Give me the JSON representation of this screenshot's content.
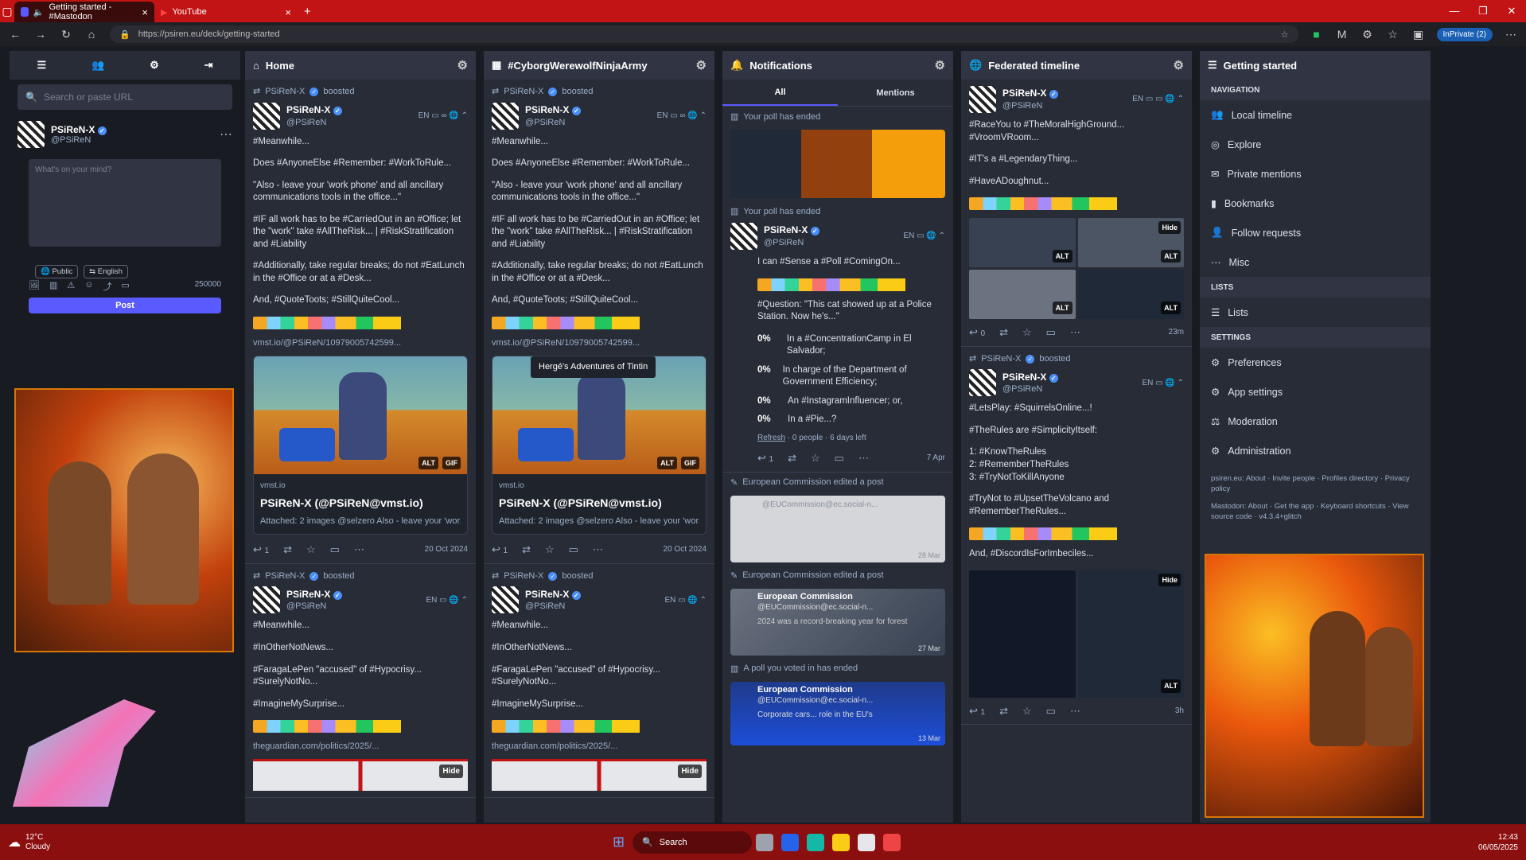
{
  "browser": {
    "tabs": [
      {
        "label": "Getting started - #Mastodon"
      },
      {
        "label": "YouTube"
      }
    ],
    "url": "https://psiren.eu/deck/getting-started",
    "inprivate_label": "InPrivate (2)"
  },
  "compose": {
    "search_placeholder": "Search or paste URL",
    "profile_name": "PSiReN-X",
    "profile_handle": "@PSiReN",
    "placeholder": "What's on your mind?",
    "visibility": "Public",
    "language": "English",
    "char_count": "250000",
    "post_label": "Post"
  },
  "columns": {
    "home": {
      "title": "Home"
    },
    "cyborg": {
      "title": "#CyborgWerewolfNinjaArmy"
    },
    "notifications": {
      "title": "Notifications",
      "tab_all": "All",
      "tab_mentions": "Mentions"
    },
    "federated": {
      "title": "Federated timeline"
    },
    "getting_started": {
      "title": "Getting started"
    }
  },
  "post1": {
    "booster": "PSiReN-X",
    "boosted": "boosted",
    "name": "PSiReN-X",
    "handle": "@PSiReN",
    "lang": "EN",
    "l1": "#Meanwhile...",
    "l2": "Does #AnyoneElse #Remember: #WorkToRule...",
    "l3": "\"Also - leave your 'work phone' and all ancillary communications tools in the office...\"",
    "l4": "#IF all work has to be #CarriedOut in an #Office; let the \"work\" take #AllTheRisk... | #RiskStratification and #Liability",
    "l5": "#Additionally, take regular breaks; do not #EatLunch in the #Office or at a #Desk...",
    "l6": "And, #QuoteToots; #StillQuiteCool...",
    "link": "vmst.io/@PSiReN/10979005742599...",
    "card_src": "vmst.io",
    "card_title": "PSiReN-X (@PSiReN@vmst.io)",
    "card_desc": "Attached: 2 images @selzero Also - leave your 'wor...",
    "alt": "ALT",
    "gif": "GIF",
    "tooltip": "Hergé's Adventures of Tintin",
    "replies": "1",
    "date": "20 Oct 2024"
  },
  "post2": {
    "l1": "#Meanwhile...",
    "l2": "#InOtherNotNews...",
    "l3": "#FaragaLePen \"accused\" of #Hypocrisy... #SurelyNotNo...",
    "l4": "#ImagineMySurprise...",
    "link": "theguardian.com/politics/2025/...",
    "hide": "Hide"
  },
  "notifications": {
    "poll_ended": "Your poll has ended",
    "poll_voted": "A poll you voted in has ended",
    "edited": "European Commission edited a post",
    "p_l1": "I can #Sense a #Poll #ComingOn...",
    "p_q": "#Question: \"This cat showed up at a Police Station. Now he's...\"",
    "options": [
      {
        "pct": "0%",
        "text": "In a #ConcentrationCamp in El Salvador;"
      },
      {
        "pct": "0%",
        "text": "In charge of the Department of Government Efficiency;"
      },
      {
        "pct": "0%",
        "text": "An #InstagramInfluencer; or,"
      },
      {
        "pct": "0%",
        "text": "In a #Pie...?"
      }
    ],
    "refresh": "Refresh",
    "poll_meta": "· 0 people · 6 days left",
    "poll_date": "7 Apr",
    "ec_name": "European Commission",
    "ec_handle": "@EUCommission@ec.social-n...",
    "ec_date1": "28 Mar",
    "ec_text": "2024 was a record-breaking year for forest",
    "ec_date2": "27 Mar",
    "ec_text2": "Corporate cars... role in the EU's",
    "ec_date3": "13 Mar"
  },
  "federated": {
    "l1": "#RaceYou to #TheMoralHighGround... #VroomVRoom...",
    "l2": "#IT's a #LegendaryThing...",
    "l3": "#HaveADoughnut...",
    "time1": "23m",
    "b_l1": "#LetsPlay: #SquirrelsOnline...!",
    "b_l2": "#TheRules are #SimplicityItself:",
    "b_r1": "1: #KnowTheRules",
    "b_r2": "2: #RememberTheRules",
    "b_r3": "3: #TryNotToKillAnyone",
    "b_l3": "#TryNot to #UpsetTheVolcano and #RememberTheRules...",
    "b_l4": "And, #DiscordIsForImbeciles...",
    "time2": "3h",
    "hide": "Hide",
    "alt": "ALT"
  },
  "menu": {
    "navigation": "NAVIGATION",
    "items": [
      "Local timeline",
      "Explore",
      "Private mentions",
      "Bookmarks",
      "Follow requests",
      "Misc"
    ],
    "lists": "LISTS",
    "lists_item": "Lists",
    "settings": "SETTINGS",
    "settings_items": [
      "Preferences",
      "App settings",
      "Moderation",
      "Administration"
    ],
    "footer1": "psiren.eu: About · Invite people · Profiles directory · Privacy policy",
    "footer2": "Mastodon: About · Get the app · Keyboard shortcuts · View source code · v4.3.4+glitch"
  },
  "taskbar": {
    "temp": "12°C",
    "weather": "Cloudy",
    "search": "Search",
    "time": "12:43",
    "date": "06/05/2025"
  },
  "colors": {
    "accent": "#595aff",
    "link": "#8c8dff",
    "chrome": "#c21414"
  }
}
